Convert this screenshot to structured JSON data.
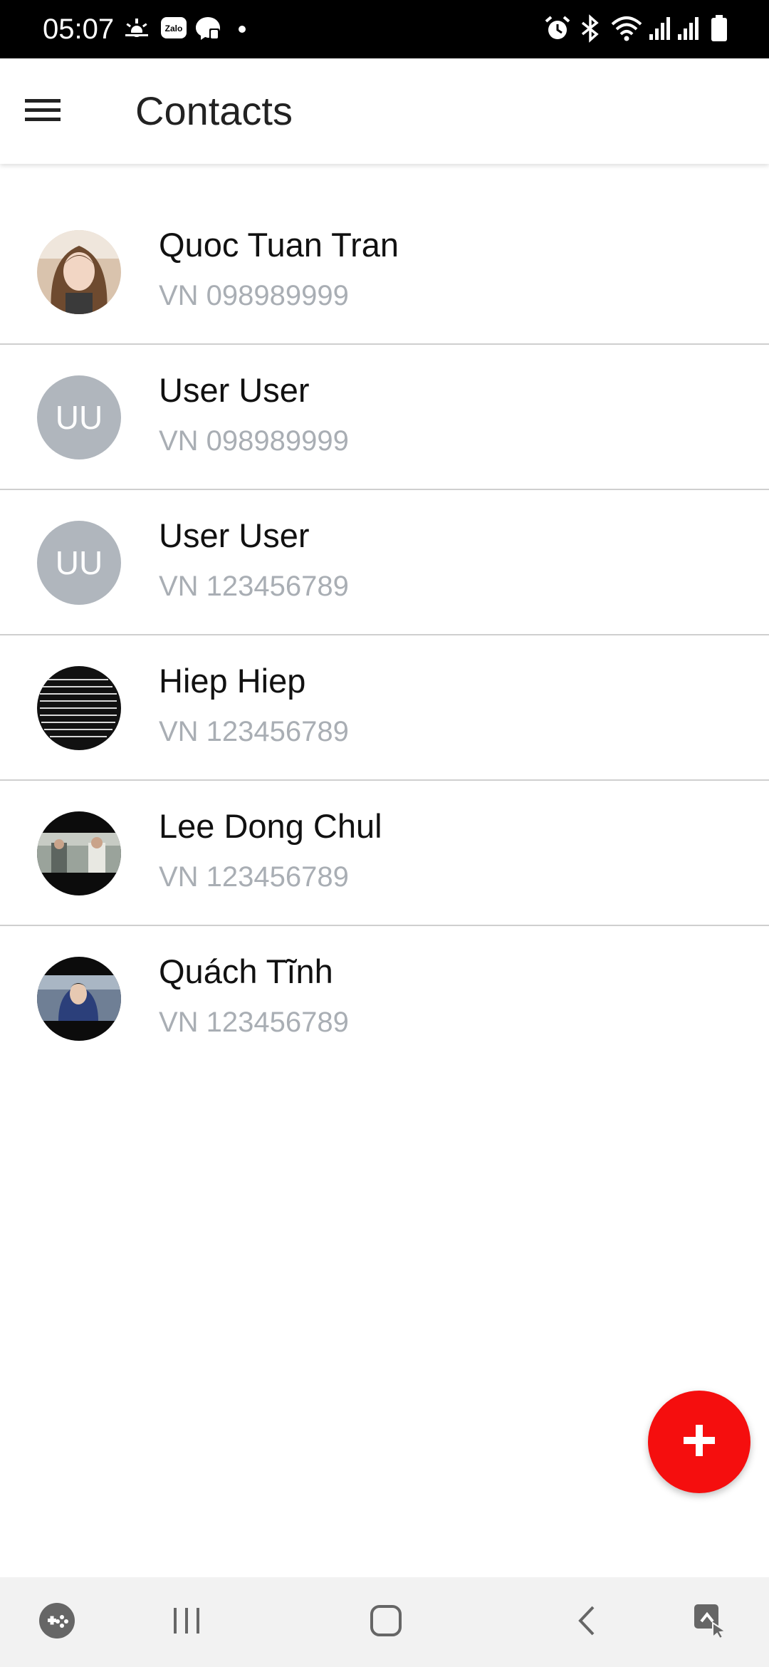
{
  "status_bar": {
    "time": "05:07",
    "left_icons": [
      "weather-sunrise-icon",
      "zalo-icon",
      "messenger-icon",
      "dot-icon"
    ],
    "zalo_label": "Zalo",
    "right_icons": [
      "alarm-icon",
      "bluetooth-icon",
      "wifi-icon",
      "signal-icon",
      "signal-icon",
      "battery-icon"
    ]
  },
  "app_bar": {
    "title": "Contacts",
    "menu_icon": "hamburger-menu-icon"
  },
  "contacts": [
    {
      "name": "Quoc Tuan Tran",
      "phone": "VN 098989999",
      "avatar_type": "photo",
      "initials": ""
    },
    {
      "name": "User User",
      "phone": "VN 098989999",
      "avatar_type": "initials",
      "initials": "UU"
    },
    {
      "name": "User User",
      "phone": "VN 123456789",
      "avatar_type": "initials",
      "initials": "UU"
    },
    {
      "name": "Hiep Hiep",
      "phone": "VN 123456789",
      "avatar_type": "photo",
      "initials": ""
    },
    {
      "name": "Lee Dong Chul",
      "phone": "VN 123456789",
      "avatar_type": "photo",
      "initials": ""
    },
    {
      "name": "Quách Tĩnh",
      "phone": "VN 123456789",
      "avatar_type": "photo",
      "initials": ""
    }
  ],
  "fab": {
    "icon": "plus-icon",
    "color": "#f50e0e"
  },
  "nav_bar": {
    "icons": [
      "game-launcher-icon",
      "recent-apps-icon",
      "home-icon",
      "back-icon",
      "assistant-touch-icon"
    ]
  },
  "colors": {
    "accent": "#f50e0e",
    "avatar_placeholder": "#b0b6bd",
    "phone_text": "#a9aeb4"
  }
}
